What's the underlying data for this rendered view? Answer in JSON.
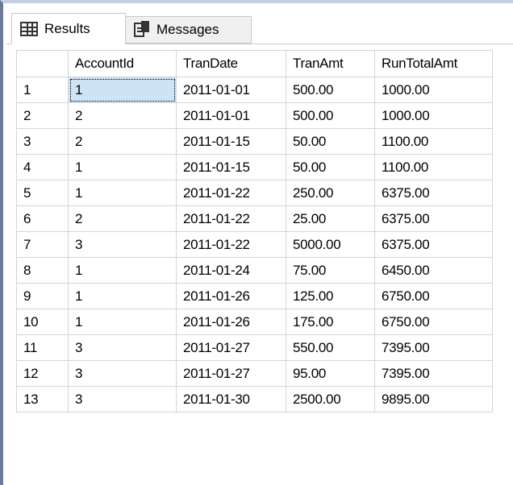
{
  "tabs": {
    "results_label": "Results",
    "messages_label": "Messages"
  },
  "grid": {
    "columns": [
      "",
      "AccountId",
      "TranDate",
      "TranAmt",
      "RunTotalAmt"
    ],
    "rows": [
      [
        "1",
        "1",
        "2011-01-01",
        "500.00",
        "1000.00"
      ],
      [
        "2",
        "2",
        "2011-01-01",
        "500.00",
        "1000.00"
      ],
      [
        "3",
        "2",
        "2011-01-15",
        "50.00",
        "1100.00"
      ],
      [
        "4",
        "1",
        "2011-01-15",
        "50.00",
        "1100.00"
      ],
      [
        "5",
        "1",
        "2011-01-22",
        "250.00",
        "6375.00"
      ],
      [
        "6",
        "2",
        "2011-01-22",
        "25.00",
        "6375.00"
      ],
      [
        "7",
        "3",
        "2011-01-22",
        "5000.00",
        "6375.00"
      ],
      [
        "8",
        "1",
        "2011-01-24",
        "75.00",
        "6450.00"
      ],
      [
        "9",
        "1",
        "2011-01-26",
        "125.00",
        "6750.00"
      ],
      [
        "10",
        "1",
        "2011-01-26",
        "175.00",
        "6750.00"
      ],
      [
        "11",
        "3",
        "2011-01-27",
        "550.00",
        "7395.00"
      ],
      [
        "12",
        "3",
        "2011-01-27",
        "95.00",
        "7395.00"
      ],
      [
        "13",
        "3",
        "2011-01-30",
        "2500.00",
        "9895.00"
      ]
    ]
  },
  "icons": {
    "results_tab": "grid-icon",
    "messages_tab": "messages-icon"
  },
  "colors": {
    "selected_cell": "#cfe3f7",
    "grid_lines": "#d4d4d4"
  }
}
